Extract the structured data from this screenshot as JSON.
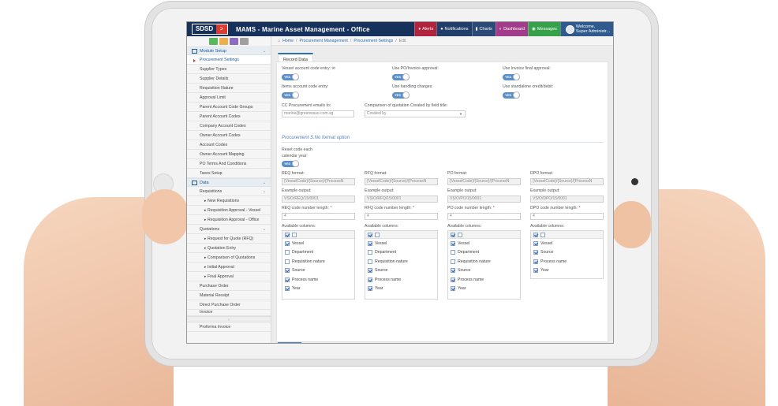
{
  "app": {
    "logo_main": "SDSD",
    "logo_accent": ">",
    "title": "MAMS - Marine Asset Management - Office"
  },
  "topbar": {
    "alerts": "Alerts",
    "notifications": "Notifications",
    "charts": "Charts",
    "dashboard": "Dashboard",
    "messages": "Messages",
    "user_welcome": "Welcome,",
    "user_name": "Super Administr..."
  },
  "breadcrumb": {
    "home": "Home",
    "items": [
      "Procurement Management",
      "Procurement Settings",
      "Edit"
    ]
  },
  "sidebar": {
    "section1": "Module Setup",
    "items1": [
      "Procurement Settings",
      "Supplier Types",
      "Supplier Details",
      "Requisition Nature",
      "Approval Limit",
      "Parent Account Code Groups",
      "Parent Account Codes",
      "Company Account Codes",
      "Owner Account Codes",
      "Account Codes",
      "Owner Account Mapping",
      "PO Terms And Conditions",
      "Taxes Setup"
    ],
    "section2": "Data",
    "requisitions": "Requisitions",
    "req_items": [
      "New Requisitions",
      "Requisition Approval - Vessel",
      "Requisition Approval - Office"
    ],
    "quotations": "Quotations",
    "quo_items": [
      "Request for Quote (RFQ)",
      "Quotation Entry",
      "Comparison of Quotations",
      "Initial Approval",
      "Final Approval"
    ],
    "items2": [
      "Purchase Order",
      "Material Receipt",
      "Direct Purchase Order",
      "Invoice"
    ],
    "items3": [
      "Proforma Invoice"
    ]
  },
  "tab": "Record Data",
  "form": {
    "vessel_code_label": "Vessel account code entry:",
    "po_invoice_label": "Use PO/Invoice approval:",
    "invoice_final_label": "Use Invoice final approval:",
    "items_code_label": "Items account code entry:",
    "handling_label": "Use handling charges:",
    "standalone_label": "Use standalone credit/debit:",
    "toggle_text": "YES",
    "cc_label": "CC Procurement emails to:",
    "cc_value": "marine@greenwave.com.sg",
    "comparison_label": "Comparison of quotation Created by field title:",
    "comparison_value": "Created by",
    "section_title": "Procurement S.No format option",
    "reset_label_1": "Reset code each",
    "reset_label_2": "calendar year:",
    "format_value": "{VesselCode}/{Source}/{ProcessN",
    "example_label": "Example output:",
    "available_label": "Available columns:"
  },
  "formats": [
    {
      "format_label": "REQ format:",
      "example": "VS/O/REQ/15/0001",
      "length_label": "REQ code number length:",
      "length": "4",
      "columns": [
        {
          "label": "Vessel",
          "checked": true
        },
        {
          "label": "Department",
          "checked": false
        },
        {
          "label": "Requisition nature",
          "checked": false
        },
        {
          "label": "Source",
          "checked": true
        },
        {
          "label": "Process name",
          "checked": true
        },
        {
          "label": "Year",
          "checked": true
        }
      ]
    },
    {
      "format_label": "RFQ format:",
      "example": "VS/O/RFQ/15/0001",
      "length_label": "RFQ code number length:",
      "length": "4",
      "columns": [
        {
          "label": "Vessel",
          "checked": true
        },
        {
          "label": "Department",
          "checked": false
        },
        {
          "label": "Requisition nature",
          "checked": false
        },
        {
          "label": "Source",
          "checked": true
        },
        {
          "label": "Process name",
          "checked": true
        },
        {
          "label": "Year",
          "checked": true
        }
      ]
    },
    {
      "format_label": "PO format:",
      "example": "VS/O/PO/15/0001",
      "length_label": "PO code number length:",
      "length": "4",
      "columns": [
        {
          "label": "Vessel",
          "checked": true
        },
        {
          "label": "Department",
          "checked": false
        },
        {
          "label": "Requisition nature",
          "checked": false
        },
        {
          "label": "Source",
          "checked": true
        },
        {
          "label": "Process name",
          "checked": true
        },
        {
          "label": "Year",
          "checked": true
        }
      ]
    },
    {
      "format_label": "DPO format:",
      "example": "VS/O/DPO/15/0001",
      "length_label": "DPO code number length:",
      "length": "4",
      "columns": [
        {
          "label": "Vessel",
          "checked": true
        },
        {
          "label": "Source",
          "checked": true
        },
        {
          "label": "Process name",
          "checked": true
        },
        {
          "label": "Year",
          "checked": true
        }
      ]
    }
  ],
  "colors": {
    "topbar": "#16325c",
    "accent": "#2a6fb3",
    "logo_red": "#e03a2f",
    "toggle": "#5b8fc9"
  }
}
